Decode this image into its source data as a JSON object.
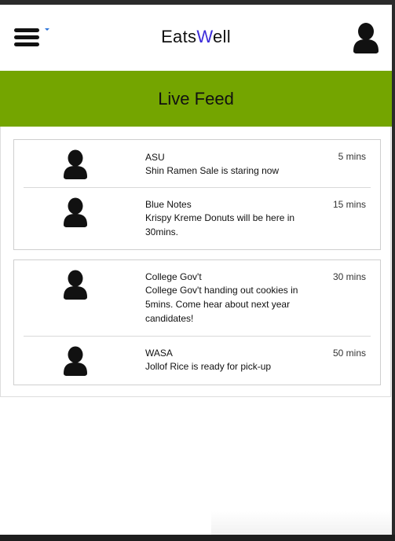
{
  "app": {
    "brand_prefix": "Eats",
    "brand_accent": "W",
    "brand_suffix": "ell"
  },
  "header": {
    "menu_icon": "hamburger-menu-icon",
    "user_icon": "user-profile-icon"
  },
  "banner": {
    "title": "Live Feed"
  },
  "feed": {
    "groups": [
      {
        "items": [
          {
            "poster": "ASU",
            "message": "Shin Ramen Sale is staring now",
            "time": "5 mins"
          },
          {
            "poster": "Blue Notes",
            "message": "Krispy Kreme Donuts will be here in 30mins.",
            "time": "15 mins"
          }
        ]
      },
      {
        "items": [
          {
            "poster": "College Gov't",
            "message": "College Gov't handing out cookies in 5mins. Come hear about next year candidates!",
            "time": "30 mins"
          },
          {
            "poster": "WASA",
            "message": "Jollof Rice is ready for pick-up",
            "time": "50 mins"
          }
        ]
      }
    ]
  },
  "colors": {
    "banner": "#74a500",
    "brand_accent": "#3b2bd9",
    "menu_caret": "#2a73d9"
  }
}
